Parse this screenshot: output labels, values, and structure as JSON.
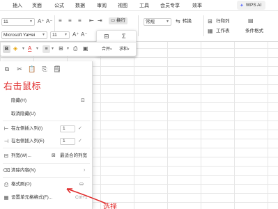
{
  "tabs": [
    "插入",
    "页面",
    "公式",
    "数据",
    "审阅",
    "视图",
    "工具",
    "会员专享",
    "效率"
  ],
  "wps_ai": "WPS AI",
  "ribbon": {
    "font_size": "11",
    "font_name": "Microsoft YaHei",
    "font_size2": "11",
    "wrap": "换行",
    "number_format": "常规",
    "convert": "转换",
    "row_col": "行和列",
    "worksheet": "工作表",
    "cond_format": "条件格式"
  },
  "mini": {
    "merge": "合并",
    "sum": "求和"
  },
  "menu": {
    "paste_only": "粘贴",
    "hide": "隐藏(H)",
    "unhide": "取消隐藏(U)",
    "insert_left": "在左侧插入列(I)",
    "insert_left_count": "1",
    "insert_right": "在右侧插入列(E)",
    "insert_right_count": "1",
    "col_width": "列宽(W)...",
    "best_fit": "最适合的列宽",
    "clear": "清除内容(N)",
    "format_painter": "格式刷(O)",
    "format_cells": "设置单元格格式(F)...",
    "format_cells_shortcut": "Ctrl+1"
  },
  "annotation": "右击鼠标",
  "annotation2": "选择",
  "colors": {
    "accent": "#e02b2b",
    "ai": "#5b6cff"
  }
}
